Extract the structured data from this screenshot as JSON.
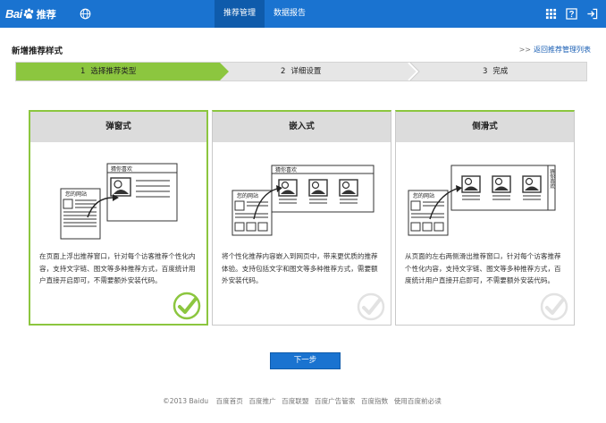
{
  "header": {
    "logo_text": "Bai",
    "logo_product": "推荐",
    "tabs": [
      {
        "label": "推荐管理",
        "active": true
      },
      {
        "label": "数据报告",
        "active": false
      }
    ],
    "icons": [
      "grid-icon",
      "help-icon",
      "logout-icon"
    ]
  },
  "page": {
    "title": "新增推荐样式",
    "back_link": "返回推荐管理列表"
  },
  "steps": [
    {
      "num": "1",
      "label": "选择推荐类型",
      "active": true
    },
    {
      "num": "2",
      "label": "详细设置",
      "active": false
    },
    {
      "num": "3",
      "label": "完成",
      "active": false
    }
  ],
  "cards": [
    {
      "title": "弹窗式",
      "selected": true,
      "site_label": "您的网站",
      "panel_label": "猜你喜欢",
      "desc": "在页面上浮出推荐窗口，针对每个访客推荐个性化内容，支持文字链、图文等多种推荐方式，百度统计用户直接开启即可，不需要额外安装代码。"
    },
    {
      "title": "嵌入式",
      "selected": false,
      "site_label": "您的网站",
      "panel_label": "猜你喜欢",
      "desc": "将个性化推荐内容嵌入到网页中，带来更优质的推荐体验。支持包括文字和图文等多种推荐方式，需要额外安装代码。"
    },
    {
      "title": "侧滑式",
      "selected": false,
      "site_label": "您的网站",
      "panel_label": "猜你喜欢",
      "desc": "从页面的左右两侧滑出推荐窗口，针对每个访客推荐个性化内容，支持文字链、图文等多种推荐方式，百度统计用户直接开启即可，不需要额外安装代码。"
    }
  ],
  "next_button": "下一步",
  "footer": {
    "copyright": "©2013 Baidu",
    "links": [
      "百度首页",
      "百度推广",
      "百度联盟",
      "百度广告管家",
      "百度指数",
      "使用百度前必读"
    ]
  },
  "colors": {
    "topbar": "#1a73d0",
    "active_tab": "#0f5bab",
    "accent_green": "#8cc63f",
    "link_blue": "#1a5fb4"
  }
}
